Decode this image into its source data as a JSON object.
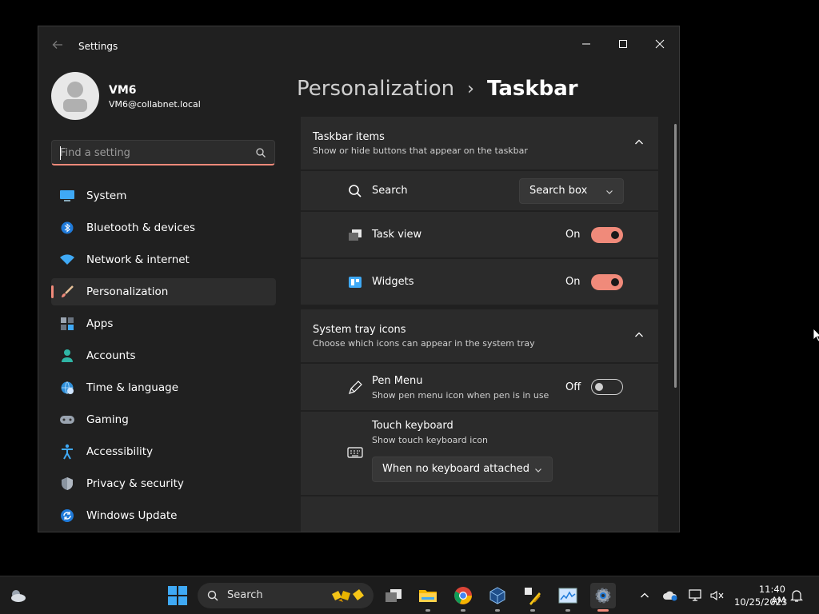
{
  "window": {
    "app_title": "Settings"
  },
  "profile": {
    "name": "VM6",
    "email": "VM6@collabnet.local"
  },
  "search": {
    "placeholder": "Find a setting"
  },
  "sidebar": {
    "items": [
      {
        "label": "System",
        "icon": "system-icon"
      },
      {
        "label": "Bluetooth & devices",
        "icon": "bluetooth-icon"
      },
      {
        "label": "Network & internet",
        "icon": "wifi-icon"
      },
      {
        "label": "Personalization",
        "icon": "brush-icon",
        "active": true
      },
      {
        "label": "Apps",
        "icon": "apps-icon"
      },
      {
        "label": "Accounts",
        "icon": "accounts-icon"
      },
      {
        "label": "Time & language",
        "icon": "globe-clock-icon"
      },
      {
        "label": "Gaming",
        "icon": "gamepad-icon"
      },
      {
        "label": "Accessibility",
        "icon": "accessibility-icon"
      },
      {
        "label": "Privacy & security",
        "icon": "shield-icon"
      },
      {
        "label": "Windows Update",
        "icon": "update-icon"
      }
    ]
  },
  "breadcrumb": {
    "parent": "Personalization",
    "separator": "›",
    "current": "Taskbar"
  },
  "taskbar_items": {
    "title": "Taskbar items",
    "subtitle": "Show or hide buttons that appear on the taskbar",
    "search": {
      "label": "Search",
      "value": "Search box"
    },
    "task_view": {
      "label": "Task view",
      "state": "On"
    },
    "widgets": {
      "label": "Widgets",
      "state": "On"
    }
  },
  "system_tray": {
    "title": "System tray icons",
    "subtitle": "Choose which icons can appear in the system tray",
    "pen_menu": {
      "label": "Pen Menu",
      "sub": "Show pen menu icon when pen is in use",
      "state": "Off"
    },
    "touch_keyboard": {
      "label": "Touch keyboard",
      "sub": "Show touch keyboard icon",
      "value": "When no keyboard attached"
    }
  },
  "taskbar": {
    "search_label": "Search",
    "time": "11:40 AM",
    "date": "10/25/2023"
  },
  "colors": {
    "accent": "#f08a7a",
    "start_blue": "#3fa9f5"
  }
}
